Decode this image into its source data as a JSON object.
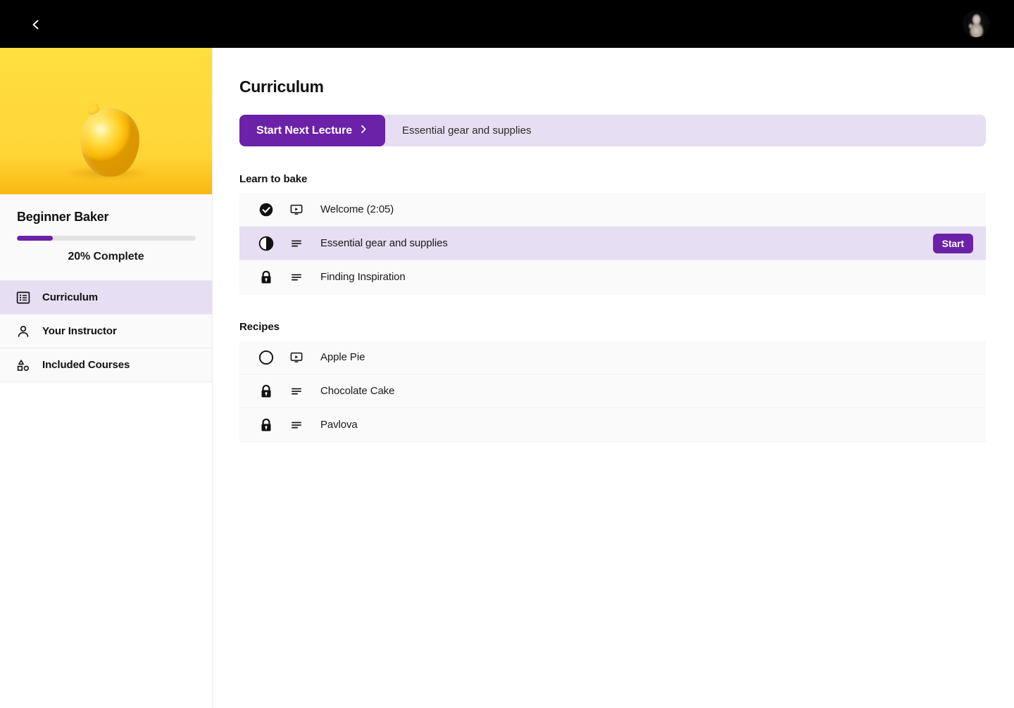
{
  "topbar": {
    "back_icon": "chevron-left-icon",
    "avatar_label": "User avatar"
  },
  "sidebar": {
    "hero_image_alt": "Lemon on yellow background",
    "course_title": "Beginner Baker",
    "progress_percent": 20,
    "progress_label": "20% Complete",
    "nav_items": [
      {
        "label": "Curriculum",
        "icon": "list-view-icon",
        "active": true
      },
      {
        "label": "Your Instructor",
        "icon": "person-icon",
        "active": false
      },
      {
        "label": "Included Courses",
        "icon": "shapes-icon",
        "active": false
      }
    ]
  },
  "main": {
    "page_title": "Curriculum",
    "next_lecture": {
      "button_label": "Start Next Lecture",
      "button_icon": "chevron-right-icon",
      "lecture_title": "Essential gear and supplies"
    },
    "sections": [
      {
        "title": "Learn to bake",
        "lessons": [
          {
            "label": "Welcome (2:05)",
            "status": "completed",
            "status_icon": "check-circle-filled-icon",
            "type": "video",
            "type_icon": "video-screen-icon",
            "action": null,
            "current": false
          },
          {
            "label": "Essential gear and supplies",
            "status": "in-progress",
            "status_icon": "half-circle-icon",
            "type": "text",
            "type_icon": "text-lines-icon",
            "action": "Start",
            "current": true
          },
          {
            "label": "Finding Inspiration",
            "status": "locked",
            "status_icon": "lock-icon",
            "type": "text",
            "type_icon": "text-lines-icon",
            "action": null,
            "current": false
          }
        ]
      },
      {
        "title": "Recipes",
        "lessons": [
          {
            "label": "Apple Pie",
            "status": "not-started",
            "status_icon": "circle-outline-icon",
            "type": "video",
            "type_icon": "video-screen-icon",
            "action": null,
            "current": false
          },
          {
            "label": "Chocolate Cake",
            "status": "locked",
            "status_icon": "lock-icon",
            "type": "text",
            "type_icon": "text-lines-icon",
            "action": null,
            "current": false
          },
          {
            "label": "Pavlova",
            "status": "locked",
            "status_icon": "lock-icon",
            "type": "text",
            "type_icon": "text-lines-icon",
            "action": null,
            "current": false
          }
        ]
      }
    ]
  },
  "colors": {
    "accent_purple": "#6B21A8",
    "accent_purple_light": "#E6DEF2",
    "row_background": "#FAFAFA",
    "topbar_background": "#000000",
    "hero_yellow": "#FFD93B"
  }
}
